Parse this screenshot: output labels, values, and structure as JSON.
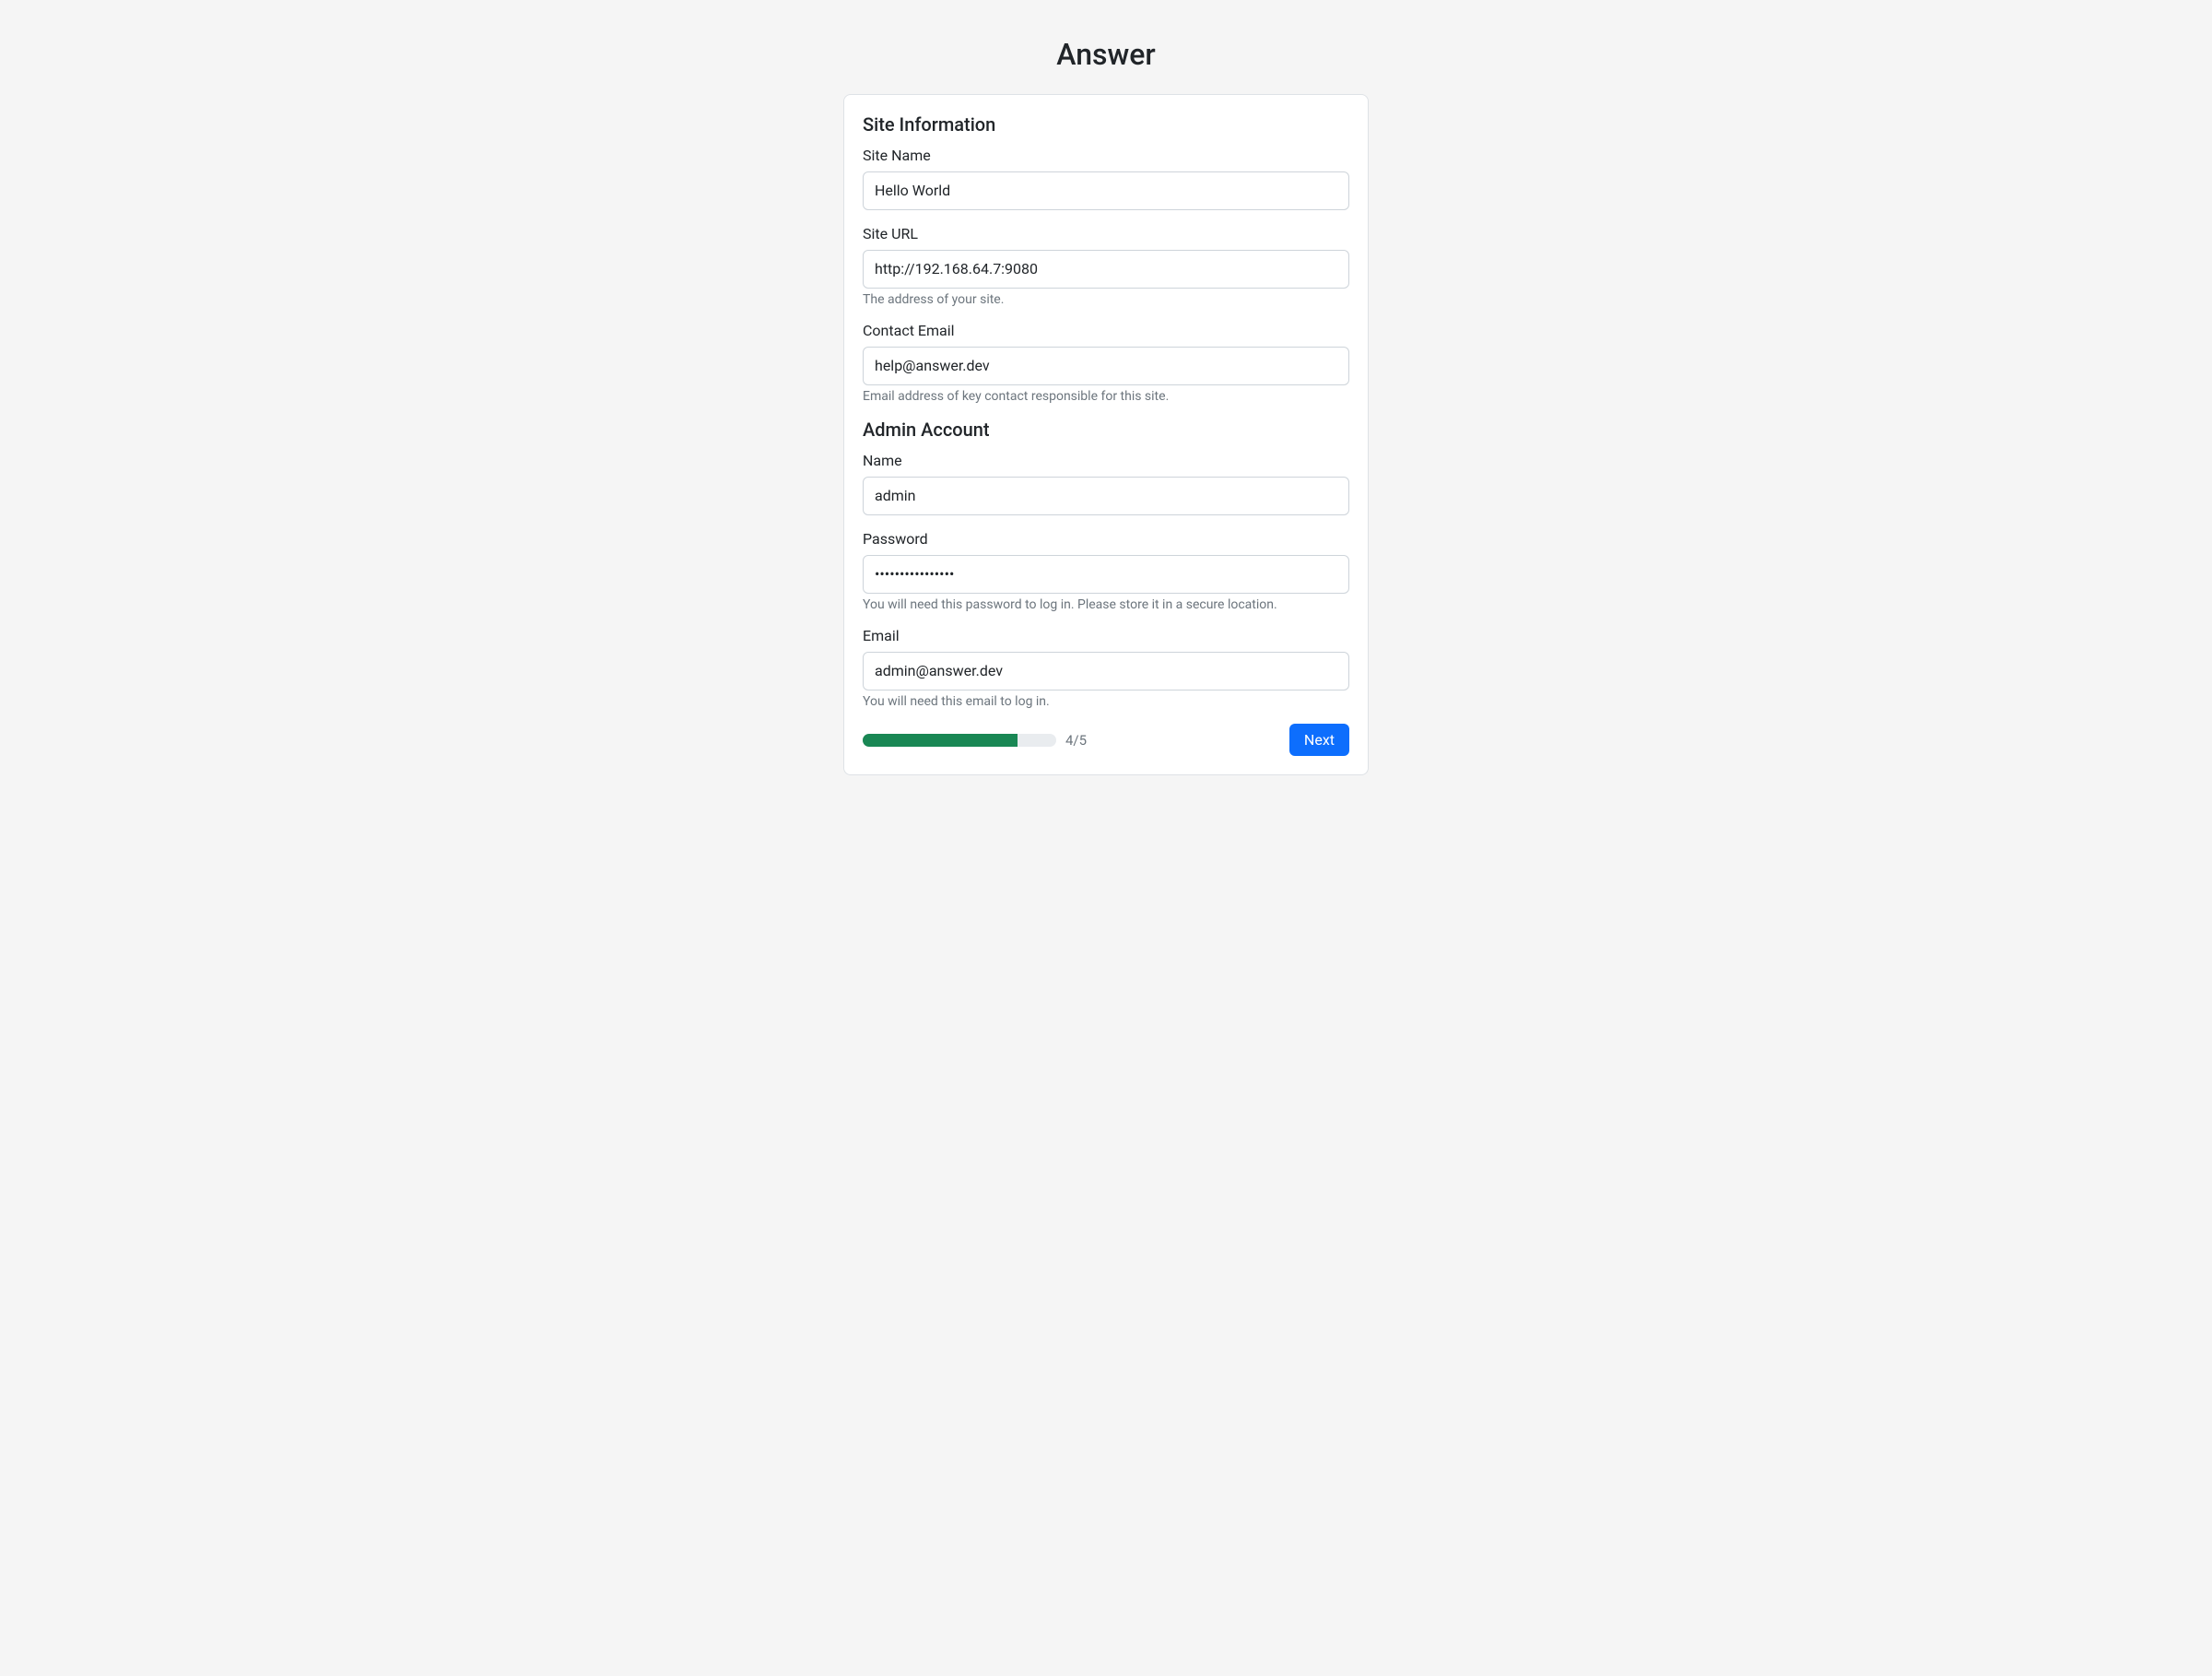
{
  "page": {
    "title": "Answer"
  },
  "siteInfo": {
    "heading": "Site Information",
    "siteName": {
      "label": "Site Name",
      "value": "Hello World"
    },
    "siteUrl": {
      "label": "Site URL",
      "value": "http://192.168.64.7:9080",
      "help": "The address of your site."
    },
    "contactEmail": {
      "label": "Contact Email",
      "value": "help@answer.dev",
      "help": "Email address of key contact responsible for this site."
    }
  },
  "adminAccount": {
    "heading": "Admin Account",
    "name": {
      "label": "Name",
      "value": "admin"
    },
    "password": {
      "label": "Password",
      "value": "••••••••••••••••",
      "help": "You will need this password to log in. Please store it in a secure location."
    },
    "email": {
      "label": "Email",
      "value": "admin@answer.dev",
      "help": "You will need this email to log in."
    }
  },
  "progress": {
    "current": 4,
    "total": 5,
    "label": "4/5",
    "percent": 80
  },
  "actions": {
    "next": "Next"
  }
}
